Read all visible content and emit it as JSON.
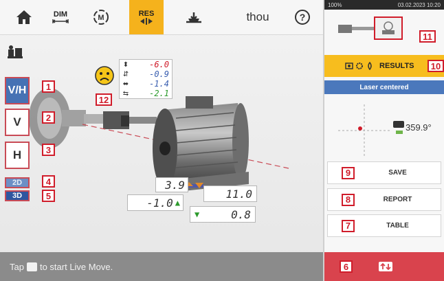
{
  "toolbar": {
    "dim_label": "DIM",
    "res_label": "RES",
    "units": "thou",
    "help_symbol": "?"
  },
  "left_buttons": {
    "vh": "V/H",
    "v": "V",
    "h": "H",
    "view_2d": "2D",
    "view_3d": "3D"
  },
  "badges": [
    "1",
    "2",
    "3",
    "4",
    "5",
    "6",
    "7",
    "8",
    "9",
    "10",
    "11",
    "12"
  ],
  "coupling_values": [
    "-6.0",
    "-0.9",
    "-1.4",
    "-2.1"
  ],
  "coupling_colors": [
    "#d01c2a",
    "#3a5fb0",
    "#3a5fb0",
    "#2c9a2c"
  ],
  "foot_values": {
    "front_vertical": "3.9",
    "rear_vertical": "11.0",
    "front_horizontal": "-1.0",
    "rear_horizontal": "0.8"
  },
  "status_text": {
    "before": "Tap",
    "after": "to start Live Move."
  },
  "phone_status": {
    "battery": "100%",
    "datetime": "03.02.2023 10:20"
  },
  "results_label": "RESULTS",
  "laser_status": "Laser centered",
  "angle": "359.9°",
  "right_buttons": {
    "save": "SAVE",
    "report": "REPORT",
    "table": "TABLE"
  },
  "colors": {
    "accent_yellow": "#f5b21c",
    "badge_red": "#d01c2a",
    "live_move_red": "#d9434d",
    "laser_blue": "#4b78bc"
  }
}
